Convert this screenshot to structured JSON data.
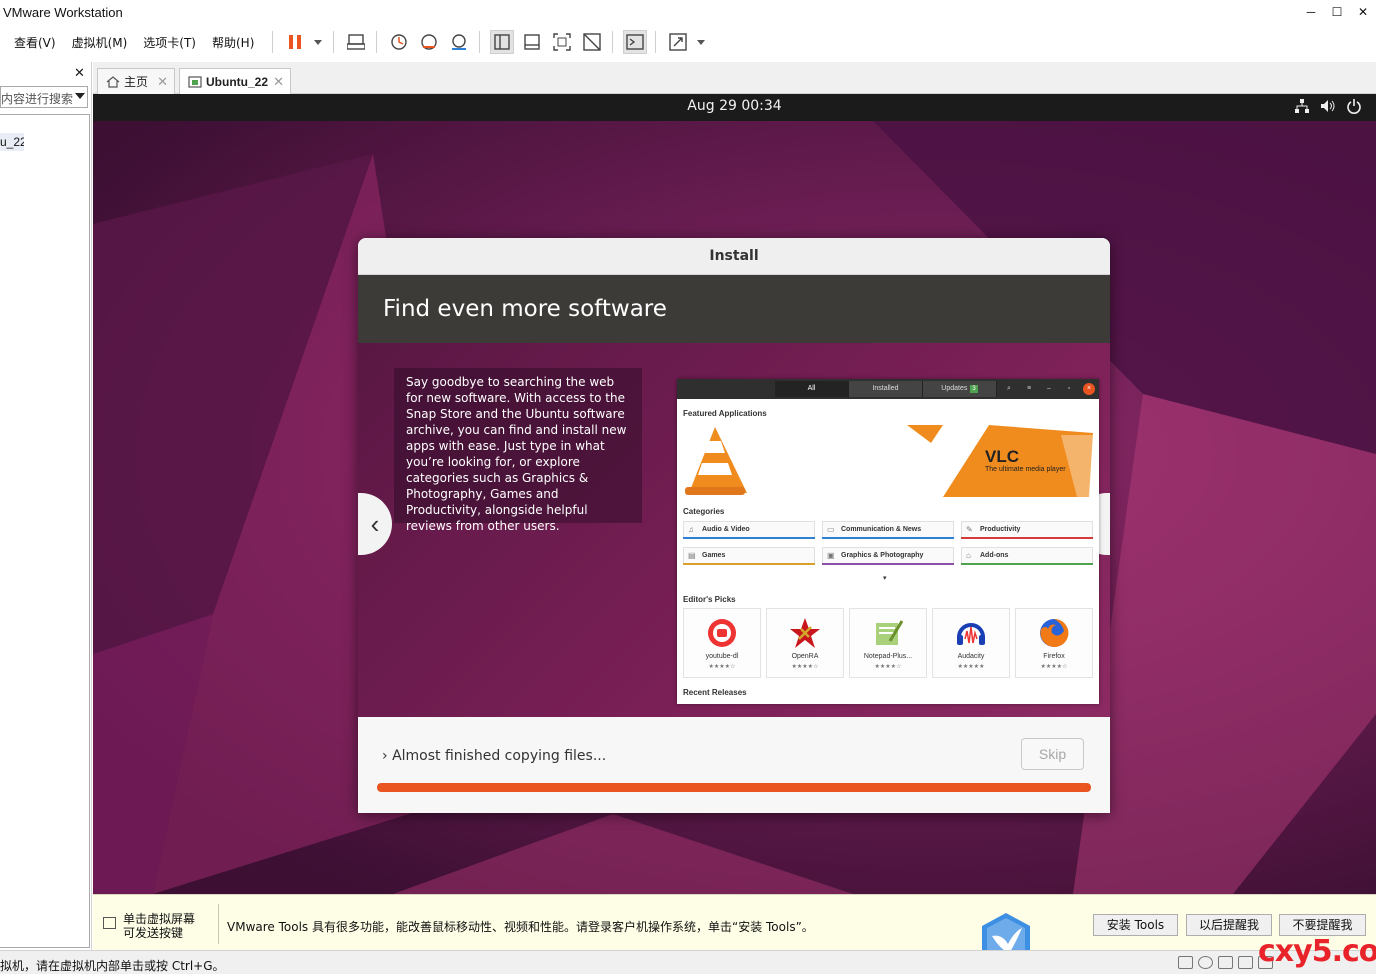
{
  "window": {
    "title": "VMware Workstation",
    "minimize": "─",
    "maximize": "☐",
    "close": "✕"
  },
  "menu": [
    "查看(V)",
    "虚拟机(M)",
    "选项卡(T)",
    "帮助(H)"
  ],
  "library": {
    "close": "✕",
    "search_placeholder": "内容进行搜索",
    "tree": [
      "",
      "u_22"
    ]
  },
  "tabs": [
    {
      "label": "主页",
      "close": "✕"
    },
    {
      "label": "Ubuntu_22",
      "close": "✕"
    }
  ],
  "gnome": {
    "clock": "Aug 29  00:34"
  },
  "installer": {
    "header": "Install",
    "slide_title": "Find even more software",
    "slide_text": "Say goodbye to searching the web for new software. With access to the Snap Store and the Ubuntu software archive, you can find and install new apps with ease. Just type in what you’re looking for, or explore categories such as Graphics & Photography, Games and Productivity, alongside helpful reviews from other users.",
    "prev": "‹",
    "next": "›",
    "progress_label": "Almost finished copying files...",
    "progress_arrow": "›",
    "skip": "Skip",
    "progress": 1.0
  },
  "software_app": {
    "tabs": [
      "All",
      "Installed",
      "Updates"
    ],
    "updates_count": "3",
    "featured": "Featured Applications",
    "vlc_title": "VLC",
    "vlc_sub": "The ultimate media player",
    "categories_title": "Categories",
    "categories": [
      {
        "label": "Audio & Video",
        "color": "#2e7fd6",
        "icon": "♫"
      },
      {
        "label": "Communication & News",
        "color": "#2e7fd6",
        "icon": "▭"
      },
      {
        "label": "Productivity",
        "color": "#d43b3b",
        "icon": "✎"
      },
      {
        "label": "Games",
        "color": "#d9a02e",
        "icon": "▤"
      },
      {
        "label": "Graphics & Photography",
        "color": "#8a4fa8",
        "icon": "▣"
      },
      {
        "label": "Add-ons",
        "color": "#4fa34f",
        "icon": "⌂"
      }
    ],
    "editors_picks_title": "Editor's Picks",
    "picks": [
      {
        "name": "youtube-dl",
        "stars": "★★★★☆"
      },
      {
        "name": "OpenRA",
        "stars": "★★★★☆"
      },
      {
        "name": "Notepad-Plus...",
        "stars": "★★★★☆"
      },
      {
        "name": "Audacity",
        "stars": "★★★★★"
      },
      {
        "name": "Firefox",
        "stars": "★★★★☆"
      }
    ],
    "recent_releases": "Recent Releases",
    "more_caret": "▾"
  },
  "notification": {
    "hint_line1": "单击虚拟屏幕",
    "hint_line2": "可发送按键",
    "message": "VMware Tools 具有很多功能，能改善鼠标移动性、视频和性能。请登录客户机操作系统，单击“安装 Tools”。",
    "buttons": [
      "安装 Tools",
      "以后提醒我",
      "不要提醒我"
    ]
  },
  "status": {
    "text": "拟机，请在虚拟机内部单击或按 Ctrl+G。"
  },
  "watermark": "cxy5.com",
  "colors": {
    "ubuntu_orange": "#e95420",
    "dialog_title_bg": "#3c3b37",
    "vm_purple": "#6a1d52"
  }
}
